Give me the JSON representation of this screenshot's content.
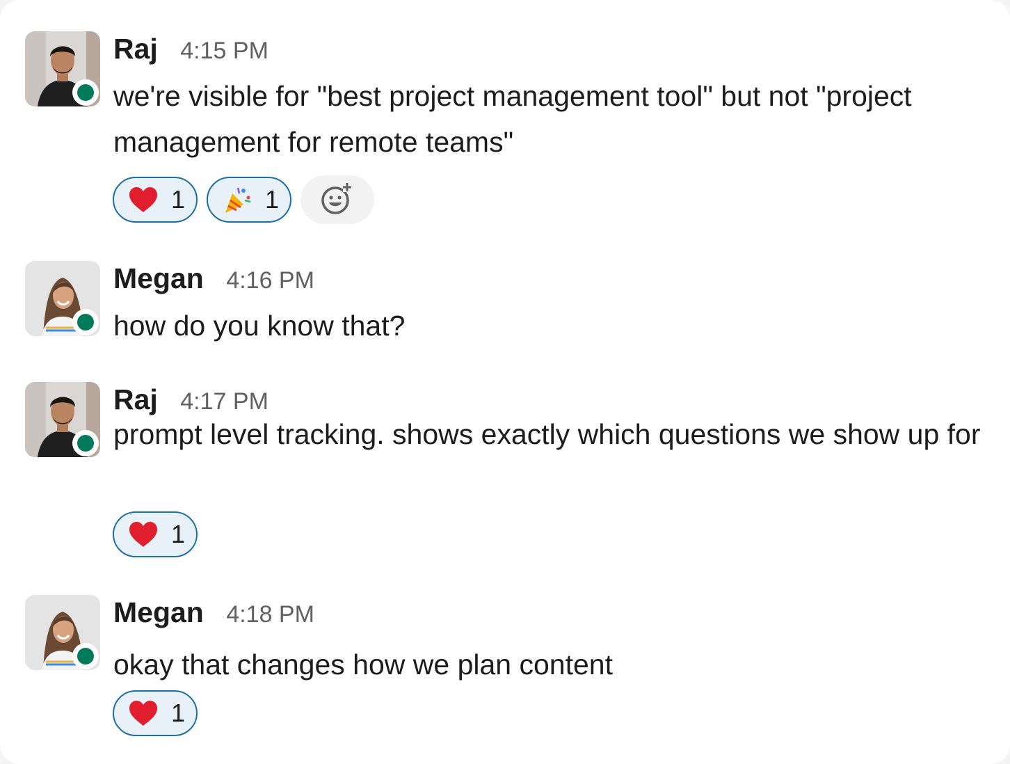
{
  "messages": [
    {
      "author": "Raj",
      "time": "4:15 PM",
      "text": "we're visible for \"best project management tool\" but not \"project management for remote teams\"",
      "reactions": [
        {
          "emoji": "heart-icon",
          "count": "1"
        },
        {
          "emoji": "party-popper-icon",
          "count": "1"
        }
      ]
    },
    {
      "author": "Megan",
      "time": "4:16 PM",
      "text": "how do you know that?",
      "reactions": []
    },
    {
      "author": "Raj",
      "time": "4:17 PM",
      "text": "prompt level tracking. shows exactly which questions we show up for",
      "reactions": [
        {
          "emoji": "heart-icon",
          "count": "1"
        }
      ]
    },
    {
      "author": "Megan",
      "time": "4:18 PM",
      "text": "okay that changes how we plan content",
      "reactions": [
        {
          "emoji": "heart-icon",
          "count": "1"
        }
      ]
    }
  ],
  "colors": {
    "presence": "#007a5a",
    "reaction_border": "#1d6fa5",
    "reaction_bg": "#e8f0f8",
    "heart": "#e01e2d"
  }
}
